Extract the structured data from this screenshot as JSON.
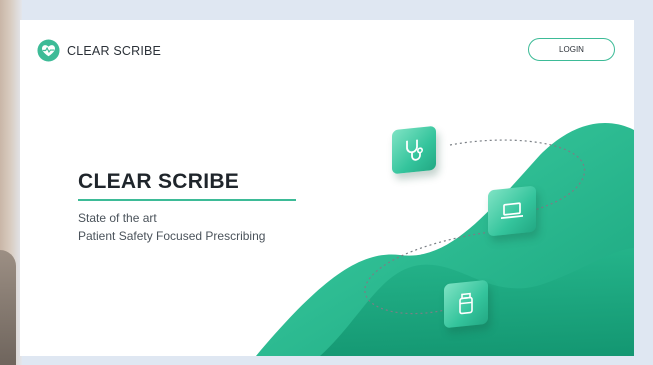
{
  "brand": {
    "name": "CLEAR SCRIBE",
    "accent_color": "#3dbb97",
    "logo_icon": "heart-pulse-icon"
  },
  "nav": {
    "login_label": "LOGIN"
  },
  "hero": {
    "title": "CLEAR SCRIBE",
    "subtitle_line1": "State of the art",
    "subtitle_line2": "Patient Safety Focused Prescribing"
  },
  "illustration": {
    "icons": [
      "stethoscope-icon",
      "laptop-icon",
      "medicine-bottle-icon"
    ],
    "wave_colors": [
      "#2fc296",
      "#17a77e"
    ]
  }
}
